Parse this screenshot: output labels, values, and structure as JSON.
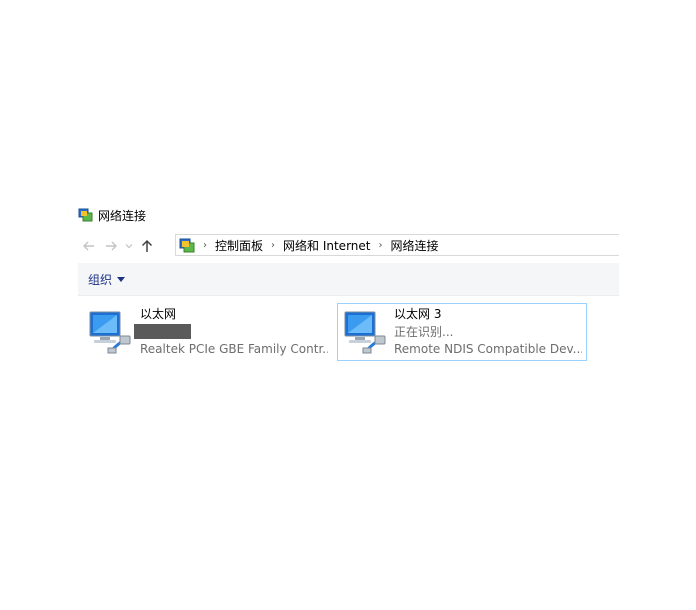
{
  "window": {
    "title": "网络连接"
  },
  "navigation": {
    "breadcrumbs": [
      "控制面板",
      "网络和 Internet",
      "网络连接"
    ]
  },
  "toolbar": {
    "organize_label": "组织"
  },
  "connections": [
    {
      "name": "以太网",
      "status": "",
      "device": "Realtek PCIe GBE Family Contr...",
      "selected": false
    },
    {
      "name": "以太网 3",
      "status": "正在识别...",
      "device": "Remote NDIS Compatible Dev...",
      "selected": true
    }
  ],
  "icons": {
    "title": "network-connections-icon",
    "back": "back-arrow-icon",
    "forward": "forward-arrow-icon",
    "recent": "chevron-down-icon",
    "up": "up-arrow-icon",
    "address": "control-panel-icon",
    "connection": "ethernet-adapter-icon"
  }
}
